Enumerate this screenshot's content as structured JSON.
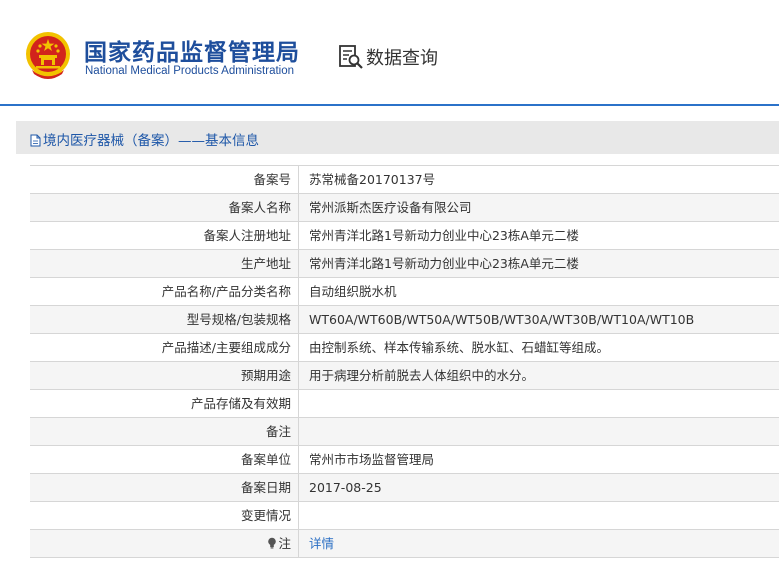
{
  "header": {
    "agency_name_cn": "国家药品监督管理局",
    "agency_name_en": "National Medical Products Administration",
    "data_query_label": "数据查询"
  },
  "panel": {
    "title": "境内医疗器械（备案）——基本信息"
  },
  "rows": [
    {
      "label": "备案号",
      "value": "苏常械备20170137号"
    },
    {
      "label": "备案人名称",
      "value": "常州派斯杰医疗设备有限公司"
    },
    {
      "label": "备案人注册地址",
      "value": "常州青洋北路1号新动力创业中心23栋A单元二楼"
    },
    {
      "label": "生产地址",
      "value": "常州青洋北路1号新动力创业中心23栋A单元二楼"
    },
    {
      "label": "产品名称/产品分类名称",
      "value": "自动组织脱水机"
    },
    {
      "label": "型号规格/包装规格",
      "value": "WT60A/WT60B/WT50A/WT50B/WT30A/WT30B/WT10A/WT10B"
    },
    {
      "label": "产品描述/主要组成成分",
      "value": "由控制系统、样本传输系统、脱水缸、石蜡缸等组成。"
    },
    {
      "label": "预期用途",
      "value": "用于病理分析前脱去人体组织中的水分。"
    },
    {
      "label": "产品存储及有效期",
      "value": ""
    },
    {
      "label": "备注",
      "value": ""
    },
    {
      "label": "备案单位",
      "value": "常州市市场监督管理局"
    },
    {
      "label": "备案日期",
      "value": "2017-08-25"
    },
    {
      "label": "变更情况",
      "value": ""
    },
    {
      "label": "注",
      "value": "详情"
    }
  ],
  "colors": {
    "brand_blue": "#1e4e9c",
    "divider_blue": "#2b72c9",
    "link_blue": "#2b6fc4",
    "emblem_red": "#d2231c",
    "emblem_gold": "#f2c200"
  },
  "icons": {
    "emblem": "national-emblem-icon",
    "data_query": "document-search-icon",
    "panel_title": "document-icon",
    "note": "lightbulb-icon"
  }
}
